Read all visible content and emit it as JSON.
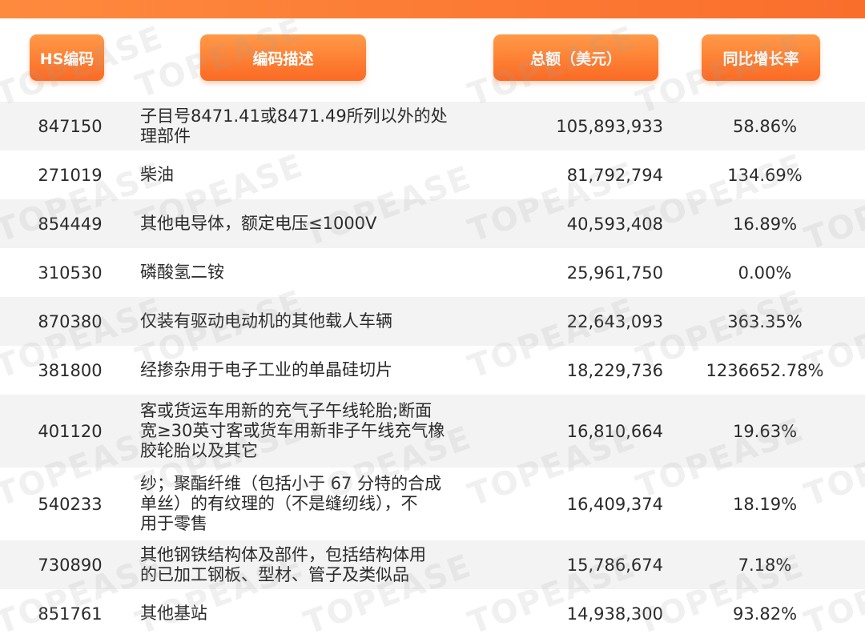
{
  "headers": {
    "hs_code": "HS编码",
    "description": "编码描述",
    "total": "总额（美元）",
    "yoy": "同比增长率"
  },
  "watermark": "TOPEASE",
  "colors": {
    "accent": "#fb6a24",
    "row_alt": "#f3f3f3"
  },
  "rows": [
    {
      "code": "847150",
      "desc": [
        "子目号8471.41或8471.49所列以外的处",
        "理部件"
      ],
      "total": "105,893,933",
      "yoy": "58.86%"
    },
    {
      "code": "271019",
      "desc": [
        "柴油"
      ],
      "total": "81,792,794",
      "yoy": "134.69%"
    },
    {
      "code": "854449",
      "desc": [
        "其他电导体，额定电压≤1000V"
      ],
      "total": "40,593,408",
      "yoy": "16.89%"
    },
    {
      "code": "310530",
      "desc": [
        "磷酸氢二铵"
      ],
      "total": "25,961,750",
      "yoy": "0.00%"
    },
    {
      "code": "870380",
      "desc": [
        "仅装有驱动电动机的其他载人车辆"
      ],
      "total": "22,643,093",
      "yoy": "363.35%"
    },
    {
      "code": "381800",
      "desc": [
        "经掺杂用于电子工业的单晶硅切片"
      ],
      "total": "18,229,736",
      "yoy": "1236652.78%"
    },
    {
      "code": "401120",
      "desc": [
        "客或货运车用新的充气子午线轮胎;断面",
        "宽≥30英寸客或货车用新非子午线充气橡",
        "胶轮胎以及其它"
      ],
      "total": "16,810,664",
      "yoy": "19.63%"
    },
    {
      "code": "540233",
      "desc": [
        "纱；聚酯纤维（包括小于 67 分特的合成",
        "单丝）的有纹理的（不是缝纫线），不",
        "用于零售"
      ],
      "total": "16,409,374",
      "yoy": "18.19%"
    },
    {
      "code": "730890",
      "desc": [
        "其他钢铁结构体及部件，包括结构体用",
        "的已加工钢板、型材、管子及类似品"
      ],
      "total": "15,786,674",
      "yoy": "7.18%"
    },
    {
      "code": "851761",
      "desc": [
        "其他基站"
      ],
      "total": "14,938,300",
      "yoy": "93.82%"
    }
  ]
}
